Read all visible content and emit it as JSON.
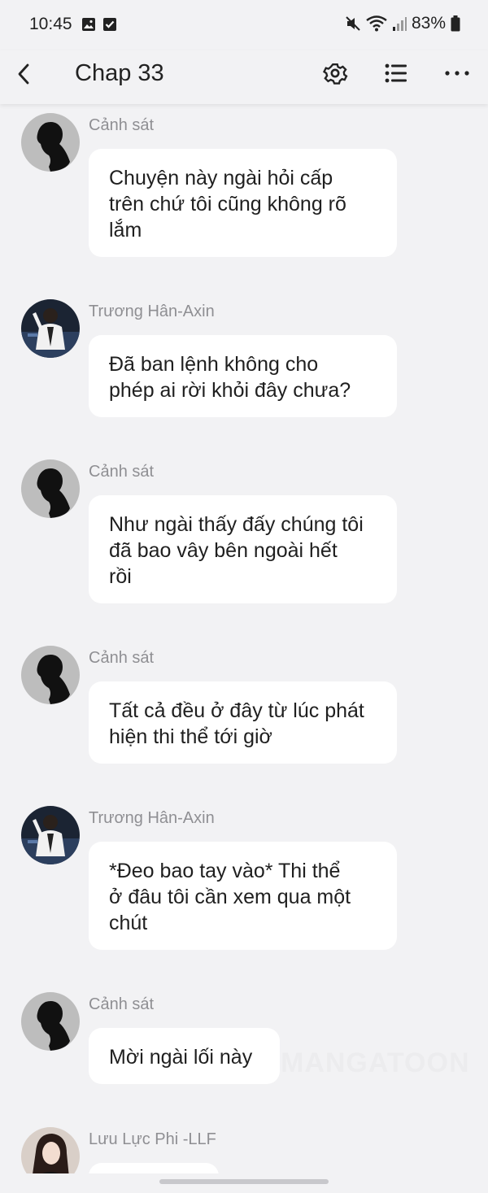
{
  "status_bar": {
    "time": "10:45",
    "battery": "83%",
    "icons": [
      "gallery-icon",
      "checkbox-icon",
      "mute-icon",
      "wifi-icon",
      "signal-icon",
      "battery-icon"
    ]
  },
  "header": {
    "title": "Chap 33",
    "icons": [
      "back-icon",
      "settings-icon",
      "list-icon",
      "more-icon"
    ]
  },
  "messages": [
    {
      "sender": "Cảnh sát",
      "avatar": "silhouette",
      "text": "Chuyện này ngài hỏi cấp\ntrên chứ tôi cũng không rõ\nlắm"
    },
    {
      "sender": "Trương Hân-Axin",
      "avatar": "photo",
      "text": "Đã ban lệnh không cho\nphép ai rời khỏi đây chưa?"
    },
    {
      "sender": "Cảnh sát",
      "avatar": "silhouette",
      "text": "Như ngài thấy đấy chúng tôi\nđã bao vây bên ngoài hết\nrồi"
    },
    {
      "sender": "Cảnh sát",
      "avatar": "silhouette",
      "text": "Tất cả đều ở đây từ lúc phát\nhiện thi thể tới giờ"
    },
    {
      "sender": "Trương Hân-Axin",
      "avatar": "photo",
      "text": "*Đeo bao tay vào* Thi thể\nở đâu tôi cần xem qua một\nchút"
    },
    {
      "sender": "Cảnh sát",
      "avatar": "silhouette",
      "text": "Mời ngài lối này"
    },
    {
      "sender": "Lưu Lực Phi -LLF",
      "avatar": "photo-woman",
      "text": ""
    }
  ],
  "watermark": "MANGATOON"
}
